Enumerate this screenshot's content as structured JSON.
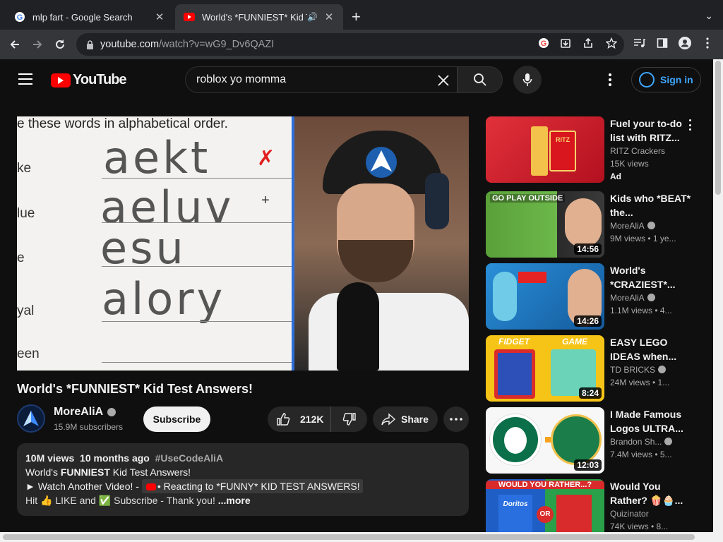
{
  "browser": {
    "tabs": [
      {
        "title": "mlp fart - Google Search",
        "icon": "google-icon",
        "active": false
      },
      {
        "title": "World's *FUNNIEST* Kid Te",
        "icon": "youtube-icon",
        "active": true
      }
    ],
    "url_host": "youtube.com",
    "url_path": "/watch?v=wG9_Dv6QAZI"
  },
  "header": {
    "logo_text": "YouTube",
    "search_query": "roblox yo momma",
    "signin_label": "Sign in"
  },
  "player": {
    "instructions": "e these words in alphabetical order.",
    "handwriting": [
      "aekt",
      "aeluv",
      "esu",
      "alory"
    ],
    "side_words": [
      "ke",
      "lue",
      "e",
      "yal",
      "een"
    ]
  },
  "video": {
    "title": "World's *FUNNIEST* Kid Test Answers!",
    "channel_name": "MoreAliA",
    "subscribers": "15.9M subscribers",
    "subscribe_label": "Subscribe",
    "likes": "212K",
    "share_label": "Share"
  },
  "description": {
    "views": "10M views",
    "age": "10 months ago",
    "hashtag": "#UseCodeAliA",
    "line1_pre": "World's ",
    "line1_bold": "FUNNIEST",
    "line1_post": " Kid Test Answers!",
    "line2_pre": "► Watch Another Video! -",
    "line2_chip": "• Reacting to *FUNNY* KID TEST ANSWERS!",
    "line3_a": "Hit 👍 LIKE and ✅ Subscribe - Thank you!",
    "line3_more": "...more"
  },
  "recommendations": [
    {
      "title": "Fuel your to-do list with RITZ...",
      "channel": "RITZ Crackers",
      "meta": "15K views",
      "badge": "Ad",
      "duration": "",
      "verified": false
    },
    {
      "title": "Kids who *BEAT* the...",
      "channel": "MoreAliA",
      "meta": "9M views • 1 ye...",
      "badge": "",
      "duration": "14:56",
      "verified": true
    },
    {
      "title": "World's *CRAZIEST*...",
      "channel": "MoreAliA",
      "meta": "1.1M views • 4...",
      "badge": "",
      "duration": "14:26",
      "verified": true
    },
    {
      "title": "EASY LEGO IDEAS when...",
      "channel": "TD BRICKS",
      "meta": "24M views • 1...",
      "badge": "",
      "duration": "8:24",
      "verified": true
    },
    {
      "title": "I Made Famous Logos ULTRA...",
      "channel": "Brandon Sh...",
      "meta": "7.4M views • 5...",
      "badge": "",
      "duration": "12:03",
      "verified": true
    },
    {
      "title": "Would You Rather? 🍿🧁...",
      "channel": "Quizinator",
      "meta": "74K views • 8...",
      "badge": "",
      "duration": "",
      "verified": false
    }
  ],
  "thumb_text": {
    "r1": "RITZ",
    "r2": "GO PLAY OUTSIDE",
    "r4a": "FIDGET",
    "r4b": "GAME",
    "r6": "WOULD YOU RATHER...?",
    "r6_or": "OR",
    "r6_doritos": "Doritos"
  },
  "colors": {
    "youtube_red": "#ff0000",
    "link_blue": "#3ea6ff",
    "background": "#0f0f0f"
  }
}
